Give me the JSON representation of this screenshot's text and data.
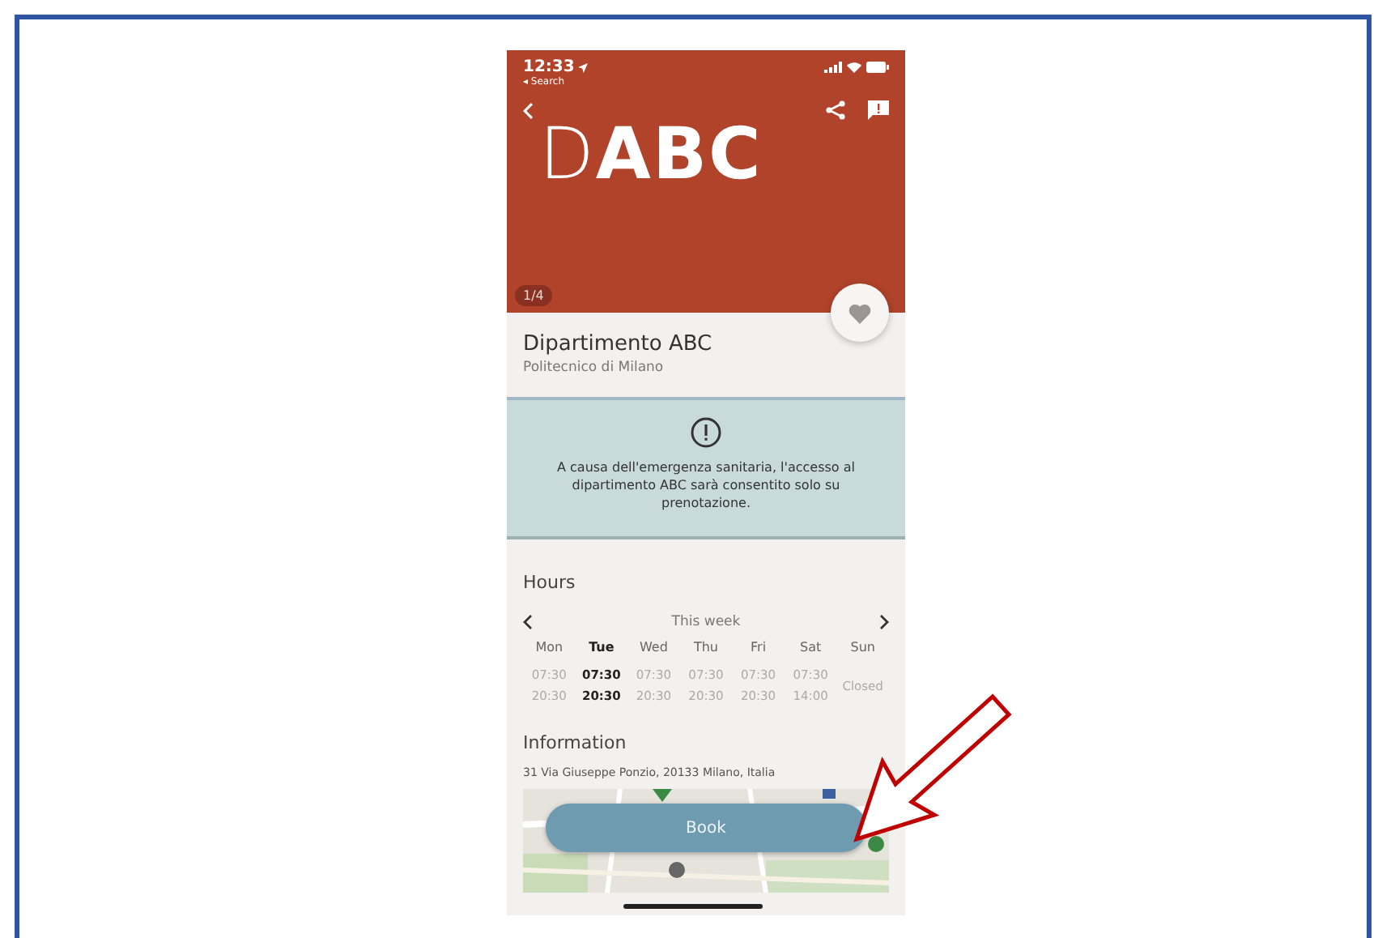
{
  "status_bar": {
    "time": "12:33",
    "back_link": "◂ Search"
  },
  "header": {
    "logo": "D**ABC**",
    "photo_counter": "1/4",
    "favorite": false
  },
  "place": {
    "name": "Dipartimento ABC",
    "subtitle": "Politecnico di Milano"
  },
  "notice": {
    "text": "A causa dell'emergenza sanitaria, l'accesso al dipartimento ABC sarà consentito solo su prenotazione."
  },
  "hours": {
    "title": "Hours",
    "week_label": "This week",
    "days": [
      {
        "kind": "hours",
        "day": "Mon",
        "open": "07:30",
        "close": "20:30",
        "selected": false
      },
      {
        "kind": "hours",
        "day": "Tue",
        "open": "07:30",
        "close": "20:30",
        "selected": true
      },
      {
        "kind": "hours",
        "day": "Wed",
        "open": "07:30",
        "close": "20:30",
        "selected": false
      },
      {
        "kind": "hours",
        "day": "Thu",
        "open": "07:30",
        "close": "20:30",
        "selected": false
      },
      {
        "kind": "hours",
        "day": "Fri",
        "open": "07:30",
        "close": "20:30",
        "selected": false
      },
      {
        "kind": "hours",
        "day": "Sat",
        "open": "07:30",
        "close": "14:00",
        "selected": false
      },
      {
        "kind": "closed",
        "day": "Sun",
        "note": "Closed",
        "selected": false
      }
    ]
  },
  "information": {
    "title": "Information",
    "address": "31 Via Giuseppe Ponzio, 20133 Milano, Italia"
  },
  "book_button": "Book"
}
